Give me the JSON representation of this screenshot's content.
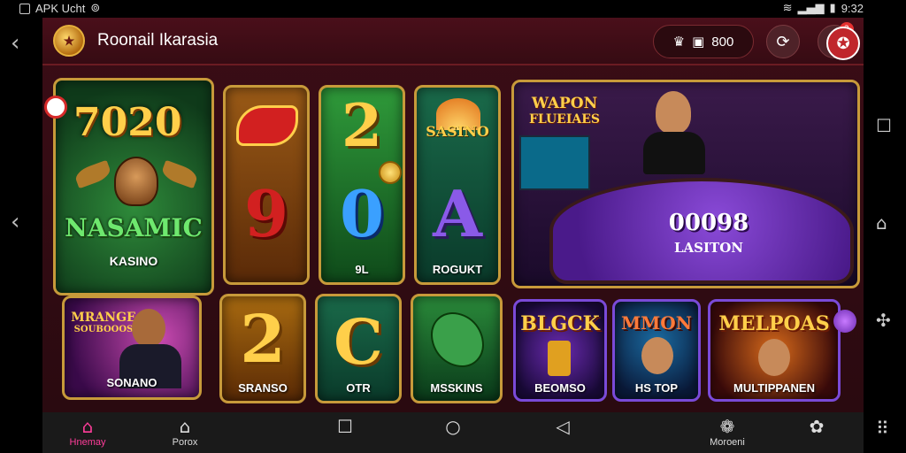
{
  "status_bar": {
    "left_text": "APK Ucht",
    "time": "9:32"
  },
  "app": {
    "title": "Roonail Ikarasia",
    "wallet_amount": "800",
    "notification_count": "2"
  },
  "tiles": {
    "featured": {
      "number": "7020",
      "name": "NASAMIC",
      "sub": "KASINO"
    },
    "reel1": {
      "glyph": "9"
    },
    "reel2": {
      "glyph": "0",
      "label": "9L"
    },
    "reel3": {
      "logo": "SASINO",
      "glyph": "A",
      "label": "ROGUKT"
    },
    "reel2_top": {
      "glyph": "2"
    },
    "live": {
      "title_line1": "WAPON",
      "title_line2": "FLUEIAES",
      "amount": "00098",
      "sub": "LASITON"
    },
    "small1": {
      "title_line1": "MRANGE",
      "title_line2": "SOUBOOOS",
      "label": "SONANO"
    },
    "small2": {
      "glyph": "2",
      "label": "SRANSO"
    },
    "small3": {
      "glyph": "C",
      "label": "OTR"
    },
    "small4": {
      "label": "MSSKINS"
    },
    "small5": {
      "title": "BLGCK",
      "label": "BEOMSO"
    },
    "small6": {
      "title": "MMON",
      "label": "HS TOP"
    },
    "small7": {
      "title": "MELPOAS",
      "label": "MULTIPPANEN"
    }
  },
  "bottom_nav": {
    "home": "Hnemay",
    "second": "Porox",
    "promo": "Moroeni"
  },
  "icons": {
    "home": "home-icon",
    "house": "house-icon",
    "square": "square-icon",
    "circle": "circle-icon",
    "triangle": "back-triangle-icon",
    "gift": "gift-icon",
    "flower": "flower-icon",
    "grid": "grid-icon"
  },
  "colors": {
    "frame_gold": "#c79a3a",
    "accent_pink": "#ff3d9a",
    "felt_purple": "#6a2fb3"
  }
}
